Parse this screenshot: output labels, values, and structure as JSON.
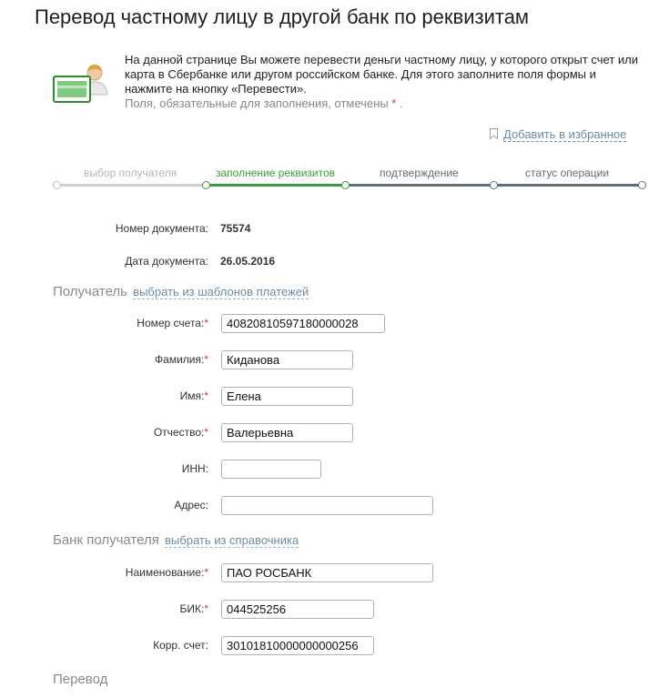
{
  "page": {
    "title": "Перевод частному лицу в другой банк по реквизитам",
    "intro_text": "На данной странице Вы можете перевести деньги частному лицу, у которого открыт счет или карта в Сбербанке или другом российском банке. Для этого заполните поля формы и нажмите на кнопку «Перевести».",
    "required_note_prefix": "Поля, обязательные для заполнения, отмечены",
    "required_mark": "*",
    "required_note_suffix": ".",
    "add_favorite_label": "Добавить в избранное"
  },
  "steps": [
    {
      "label": "выбор получателя",
      "state": "done"
    },
    {
      "label": "заполнение реквизитов",
      "state": "active"
    },
    {
      "label": "подтверждение",
      "state": "pending"
    },
    {
      "label": "статус операции",
      "state": "pending"
    }
  ],
  "document": {
    "number_label": "Номер документа:",
    "number_value": "75574",
    "date_label": "Дата документа:",
    "date_value": "26.05.2016"
  },
  "recipient": {
    "section_title": "Получатель",
    "templates_link": "выбрать из шаблонов платежей",
    "fields": {
      "account": {
        "label": "Номер счета:",
        "required": "*",
        "value": "40820810597180000028"
      },
      "surname": {
        "label": "Фамилия:",
        "required": "*",
        "value": "Киданова"
      },
      "name": {
        "label": "Имя:",
        "required": "*",
        "value": "Елена"
      },
      "patronymic": {
        "label": "Отчество:",
        "required": "*",
        "value": "Валерьевна"
      },
      "inn": {
        "label": "ИНН:",
        "value": ""
      },
      "address": {
        "label": "Адрес:",
        "value": ""
      }
    }
  },
  "bank": {
    "section_title": "Банк получателя",
    "directory_link": "выбрать из справочника",
    "fields": {
      "name": {
        "label": "Наименование:",
        "required": "*",
        "value": "ПАО РОСБАНК"
      },
      "bik": {
        "label": "БИК:",
        "required": "*",
        "value": "044525256"
      },
      "corr": {
        "label": "Корр. счет:",
        "value": "30101810000000000256"
      }
    }
  },
  "transfer": {
    "section_title": "Перевод"
  },
  "colors": {
    "accent_green": "#3a9b3a",
    "step_done": "#c8c8c8",
    "step_pending": "#5f6e79",
    "link": "#6a8ca8",
    "required": "#d33333"
  }
}
